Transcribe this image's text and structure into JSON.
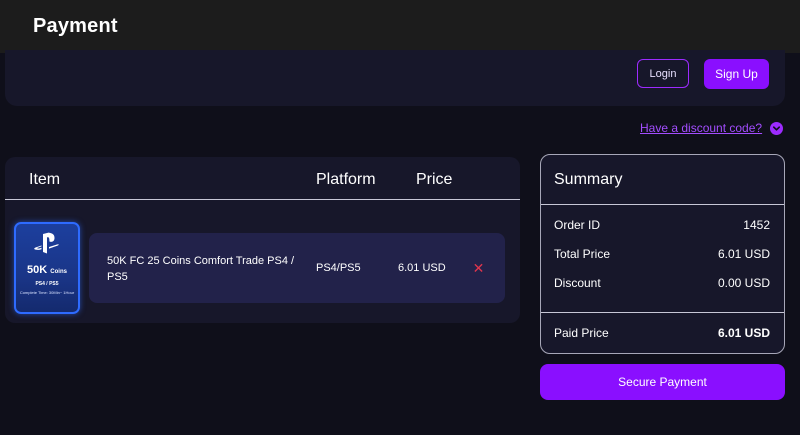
{
  "header": {
    "title": "Payment"
  },
  "auth": {
    "login_label": "Login",
    "signup_label": "Sign Up"
  },
  "discount": {
    "link_text": "Have a discount code?",
    "icon": "chevron-down-icon"
  },
  "cart": {
    "columns": {
      "item": "Item",
      "platform": "Platform",
      "price": "Price"
    },
    "items": [
      {
        "name": "50K FC 25 Coins Comfort Trade PS4 / PS5",
        "platform": "PS4/PS5",
        "price": "6.01 USD",
        "remove_icon": "close-icon",
        "thumbnail": {
          "logo": "playstation-logo",
          "amount": "50K",
          "amount_unit": "Coins",
          "platforms": "PS4 / PS5",
          "time_note": "Complete Time: 30Min~ 1Hour"
        }
      }
    ]
  },
  "summary": {
    "title": "Summary",
    "rows": [
      {
        "label": "Order ID",
        "value": "1452"
      },
      {
        "label": "Total Price",
        "value": "6.01 USD"
      },
      {
        "label": "Discount",
        "value": "0.00 USD"
      }
    ],
    "paid": {
      "label": "Paid Price",
      "value": "6.01 USD"
    }
  },
  "checkout": {
    "button_label": "Secure Payment"
  },
  "colors": {
    "accent": "#8a0fff",
    "background": "#0f0f1a",
    "panel": "#17172a",
    "remove": "#e0354d"
  }
}
